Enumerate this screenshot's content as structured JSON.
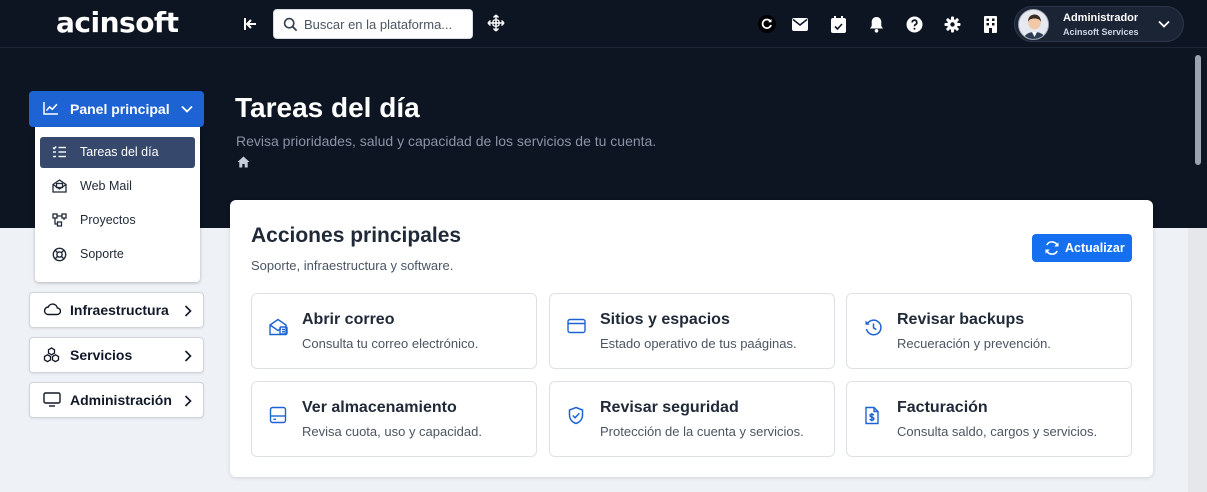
{
  "brand": {
    "logo_text": "acinsoft"
  },
  "topbar": {
    "search": {
      "placeholder": "Buscar en la plataforma..."
    },
    "icons": [
      "refresh-icon",
      "mail-icon",
      "calendar-icon",
      "bell-icon",
      "help-icon",
      "settings-icon",
      "building-icon"
    ],
    "user": {
      "name": "Administrador",
      "organization": "Acinsoft Services"
    }
  },
  "header": {
    "title": "Tareas del día",
    "subtitle": "Revisa prioridades, salud y capacidad de los servicios de tu cuenta."
  },
  "sidebar": {
    "main": {
      "label": "Panel principal",
      "icon": "chart-line-icon",
      "expanded": true
    },
    "submenu": [
      {
        "label": "Tareas del día",
        "icon": "tasks-icon",
        "active": true
      },
      {
        "label": "Web Mail",
        "icon": "mail-open-icon",
        "active": false
      },
      {
        "label": "Proyectos",
        "icon": "projects-icon",
        "active": false
      },
      {
        "label": "Soporte",
        "icon": "support-icon",
        "active": false
      }
    ],
    "items": [
      {
        "label": "Infraestructura",
        "icon": "cloud-icon"
      },
      {
        "label": "Servicios",
        "icon": "services-icon"
      },
      {
        "label": "Administración",
        "icon": "monitor-icon"
      }
    ]
  },
  "main": {
    "card_title": "Acciones principales",
    "card_subtitle": "Soporte, infraestructura y software.",
    "refresh_label": "Actualizar",
    "actions": [
      {
        "title": "Abrir correo",
        "description": "Consulta tu correo electrónico.",
        "icon": "mail-icon"
      },
      {
        "title": "Sitios y espacios",
        "description": "Estado operativo de tus paáginas.",
        "icon": "browser-icon"
      },
      {
        "title": "Revisar backups",
        "description": "Recueración y prevención.",
        "icon": "history-icon"
      },
      {
        "title": "Ver almacenamiento",
        "description": "Revisa cuota, uso y capacidad.",
        "icon": "storage-icon"
      },
      {
        "title": "Revisar seguridad",
        "description": "Protección de la cuenta y servicios.",
        "icon": "shield-icon"
      },
      {
        "title": "Facturación",
        "description": "Consulta saldo, cargos y servicios.",
        "icon": "invoice-icon"
      }
    ]
  },
  "colors": {
    "topbar_bg": "#0d1422",
    "primary": "#1d63d3",
    "button_blue": "#1570ef",
    "active_submenu": "#36486c",
    "icon_blue": "#1d63d3"
  }
}
